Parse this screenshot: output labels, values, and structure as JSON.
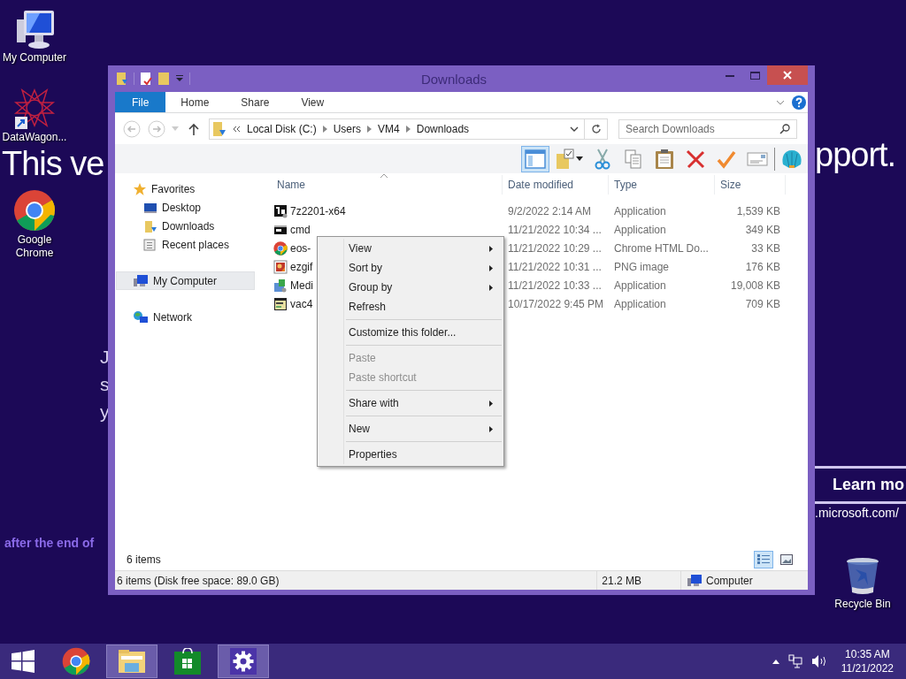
{
  "desktop_icons": [
    {
      "kind": "computer",
      "label": "My Computer"
    },
    {
      "kind": "shortcut",
      "label": "DataWagon..."
    },
    {
      "kind": "chrome",
      "label": "Google Chrome"
    }
  ],
  "recycle_bin": {
    "label": "Recycle Bin"
  },
  "wallpaper": {
    "headline_start": "This ve",
    "headline_end": "pport.",
    "lines": [
      "J",
      "s",
      "y"
    ],
    "footnote": "after the end of",
    "learn_more": "Learn mo",
    "url": ".microsoft.com/"
  },
  "window": {
    "title": "Downloads",
    "ribbon_tabs": [
      {
        "kind": "file",
        "label": "File"
      },
      {
        "kind": "tab",
        "label": "Home"
      },
      {
        "kind": "tab",
        "label": "Share"
      },
      {
        "kind": "tab",
        "label": "View"
      }
    ],
    "address_segments": [
      "Local Disk (C:)",
      "Users",
      "VM4",
      "Downloads"
    ],
    "search_placeholder": "Search Downloads",
    "toolbar": [
      {
        "kind": "pane",
        "selected": true
      },
      {
        "kind": "folder-check",
        "selected": false
      },
      {
        "kind": "cut",
        "selected": false
      },
      {
        "kind": "copy",
        "selected": false
      },
      {
        "kind": "paste",
        "selected": false
      },
      {
        "kind": "delete",
        "selected": false
      },
      {
        "kind": "check",
        "selected": false
      },
      {
        "kind": "card",
        "selected": false
      },
      {
        "kind": "shell",
        "selected": false
      }
    ],
    "nav": [
      {
        "kind": "star",
        "label": "Favorites",
        "selected": false,
        "children": [
          {
            "kind": "desktop",
            "label": "Desktop",
            "selected": false
          },
          {
            "kind": "downloads",
            "label": "Downloads",
            "selected": false
          },
          {
            "kind": "recent",
            "label": "Recent places",
            "selected": false
          }
        ]
      },
      {
        "kind": "computer",
        "label": "My Computer",
        "selected": true
      },
      {
        "kind": "network",
        "label": "Network",
        "selected": false
      }
    ],
    "columns": [
      "Name",
      "Date modified",
      "Type",
      "Size"
    ],
    "rows": [
      {
        "kind": "archive",
        "name": "7z2201-x64",
        "date": "9/2/2022 2:14 AM",
        "type": "Application",
        "size": "1,539 KB"
      },
      {
        "kind": "cmd",
        "name": "cmd",
        "date": "11/21/2022 10:34 ...",
        "type": "Application",
        "size": "349 KB"
      },
      {
        "kind": "chrome",
        "name": "eos-",
        "date": "11/21/2022 10:29 ...",
        "type": "Chrome HTML Do...",
        "size": "33 KB"
      },
      {
        "kind": "png",
        "name": "ezgif",
        "date": "11/21/2022 10:31 ...",
        "type": "PNG image",
        "size": "176 KB"
      },
      {
        "kind": "installer",
        "name": "Medi",
        "date": "11/21/2022 10:33 ...",
        "type": "Application",
        "size": "19,008 KB"
      },
      {
        "kind": "vac",
        "name": "vac4",
        "date": "10/17/2022 9:45 PM",
        "type": "Application",
        "size": "709 KB"
      }
    ],
    "item_count": "6 items",
    "view_buttons": [
      {
        "kind": "details",
        "selected": true
      },
      {
        "kind": "tiles",
        "selected": false
      }
    ],
    "status_bar": {
      "summary": "6 items (Disk free space: 89.0 GB)",
      "size": "21.2 MB",
      "location": "Computer"
    }
  },
  "context_menu": [
    {
      "kind": "item",
      "label": "View",
      "submenu": true,
      "disabled": false
    },
    {
      "kind": "item",
      "label": "Sort by",
      "submenu": true,
      "disabled": false
    },
    {
      "kind": "item",
      "label": "Group by",
      "submenu": true,
      "disabled": false
    },
    {
      "kind": "item",
      "label": "Refresh",
      "submenu": false,
      "disabled": false
    },
    {
      "kind": "separator"
    },
    {
      "kind": "item",
      "label": "Customize this folder...",
      "submenu": false,
      "disabled": false
    },
    {
      "kind": "separator"
    },
    {
      "kind": "item",
      "label": "Paste",
      "submenu": false,
      "disabled": true
    },
    {
      "kind": "item",
      "label": "Paste shortcut",
      "submenu": false,
      "disabled": true
    },
    {
      "kind": "separator"
    },
    {
      "kind": "item",
      "label": "Share with",
      "submenu": true,
      "disabled": false
    },
    {
      "kind": "separator"
    },
    {
      "kind": "item",
      "label": "New",
      "submenu": true,
      "disabled": false
    },
    {
      "kind": "separator"
    },
    {
      "kind": "item",
      "label": "Properties",
      "submenu": false,
      "disabled": false
    }
  ],
  "taskbar": {
    "apps": [
      {
        "kind": "start",
        "active": false
      },
      {
        "kind": "chrome",
        "active": false
      },
      {
        "kind": "explorer",
        "active": true
      },
      {
        "kind": "store",
        "active": false
      },
      {
        "kind": "settings",
        "active": true
      }
    ],
    "clock": {
      "time": "10:35 AM",
      "date": "11/21/2022"
    }
  }
}
